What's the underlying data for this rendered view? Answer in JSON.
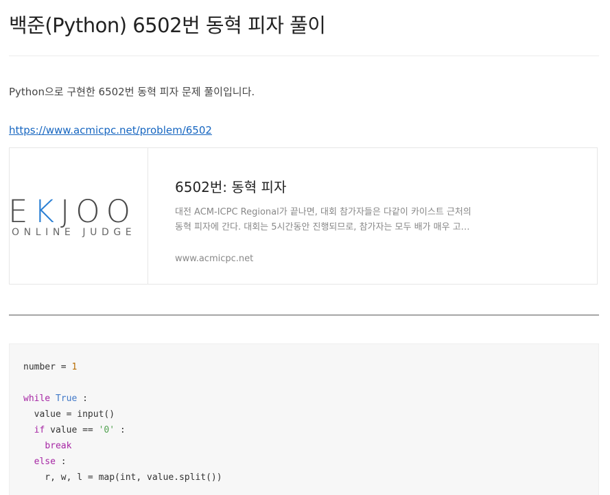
{
  "post": {
    "title": "백준(Python) 6502번 동혁 피자 풀이",
    "intro": "Python으로 구현한 6502번 동혁 피자 문제 풀이입니다.",
    "link_text": "https://www.acmicpc.net/problem/6502"
  },
  "card": {
    "logo_main_prefix": "E",
    "logo_main_k": "K",
    "logo_main_suffix": "JOO",
    "logo_sub": "ONLINE JUDGE",
    "title": "6502번: 동혁 피자",
    "desc_line1": "대전 ACM-ICPC Regional가 끝나면, 대회 참가자들은 다같이 카이스트 근처의",
    "desc_line2": "동혁 피자에 간다. 대회는 5시간동안 진행되므로, 참가자는 모두 배가 매우 고…",
    "domain": "www.acmicpc.net"
  },
  "code": {
    "l1_a": "number = ",
    "l1_num": "1",
    "l3_kw": "while",
    "l3_bi": "True",
    "l3_b": " :",
    "l4": "  value = input()",
    "l5_kw": "if",
    "l5_a": " value == ",
    "l5_str": "'0'",
    "l5_b": " :",
    "l6_kw": "break",
    "l7_kw": "else",
    "l7_b": " :",
    "l8": "    r, w, l = map(int, value.split())"
  },
  "colors": {
    "link": "#1565c0",
    "logo_accent": "#2a7fd4",
    "keyword": "#a626a4",
    "builtin": "#4078c8",
    "number": "#b76b01",
    "string": "#50a14f"
  }
}
